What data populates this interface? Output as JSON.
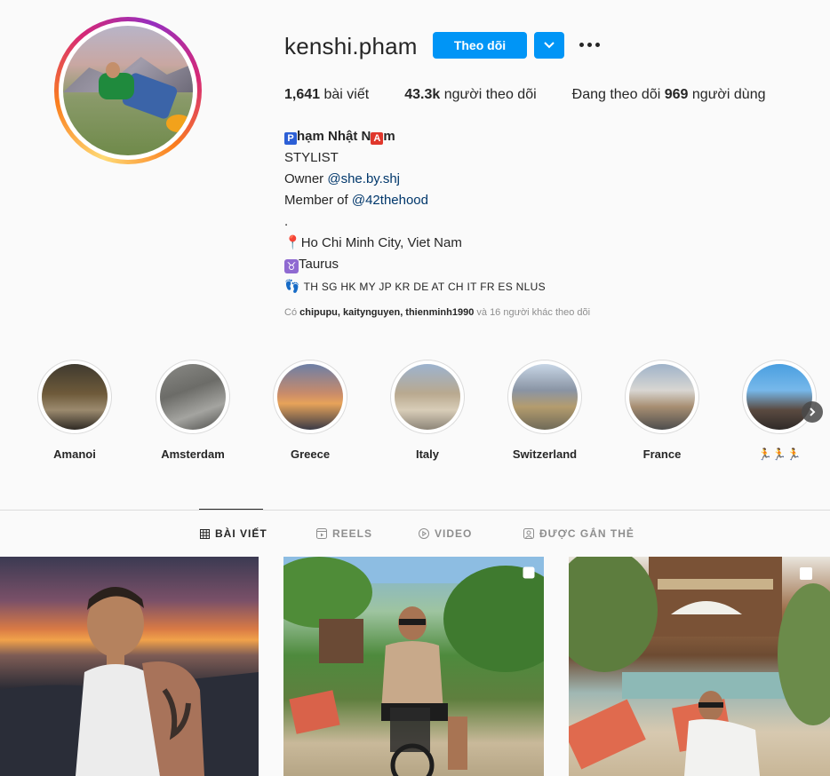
{
  "profile": {
    "username": "kenshi.pham",
    "follow_label": "Theo dõi",
    "stats": {
      "posts_count": "1,641",
      "posts_label": "bài viết",
      "followers_count": "43.3k",
      "followers_label": "người theo dõi",
      "following_prefix": "Đang theo dõi",
      "following_count": "969",
      "following_suffix": "người dùng"
    },
    "bio": {
      "name_p": "P",
      "name_mid": "hạm Nhật N",
      "name_a": "A",
      "name_end": "m",
      "line1": "STYLIST",
      "owner_prefix": "Owner ",
      "owner_handle": "@she.by.shj",
      "member_prefix": "Member of ",
      "member_handle": "@42thehood",
      "dot": ".",
      "location": "Ho Chi Minh City, Viet Nam",
      "zodiac": "Taurus",
      "countries": "TH SG HK MY JP KR DE AT CH IT FR ES NLUS"
    },
    "followed_by": {
      "prefix": "Có",
      "names": "chipupu, kaitynguyen, thienminh1990",
      "suffix": "và 16 người khác theo dõi"
    }
  },
  "highlights": [
    {
      "label": "Amanoi"
    },
    {
      "label": "Amsterdam"
    },
    {
      "label": "Greece"
    },
    {
      "label": "Italy"
    },
    {
      "label": "Switzerland"
    },
    {
      "label": "France"
    },
    {
      "label": "🏃🏃🏃"
    }
  ],
  "tabs": [
    {
      "label": "BÀI VIẾT",
      "icon": "grid-icon"
    },
    {
      "label": "REELS",
      "icon": "reels-icon"
    },
    {
      "label": "VIDEO",
      "icon": "play-icon"
    },
    {
      "label": "ĐƯỢC GẮN THẺ",
      "icon": "tagged-icon"
    }
  ],
  "colors": {
    "accent": "#0095f6",
    "text": "#262626",
    "muted": "#8e8e8e",
    "link": "#00376b"
  }
}
